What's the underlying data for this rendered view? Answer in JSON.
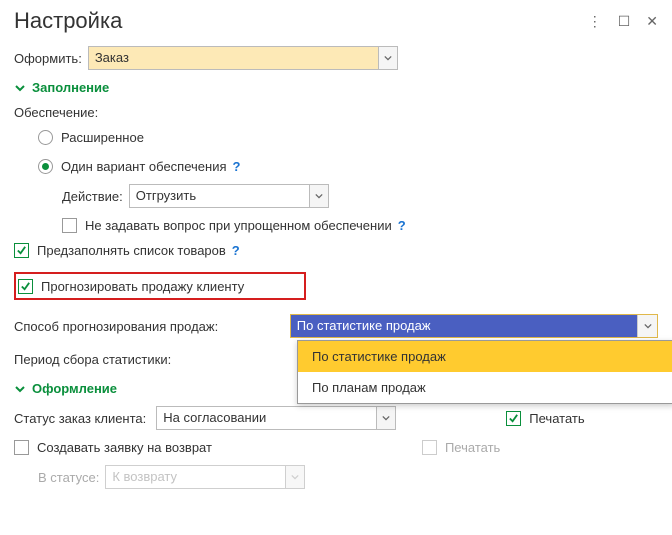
{
  "header": {
    "title": "Настройка"
  },
  "oformit": {
    "label": "Оформить:",
    "value": "Заказ"
  },
  "sections": {
    "fill": "Заполнение",
    "design": "Оформление"
  },
  "obespechenie": {
    "label": "Обеспечение:",
    "opt_extended": "Расширенное",
    "opt_single": "Один вариант обеспечения"
  },
  "action": {
    "label": "Действие:",
    "value": "Отгрузить"
  },
  "noask": "Не задавать вопрос при упрощенном обеспечении",
  "prefill": "Предзаполнять список товаров",
  "forecast_client": "Прогнозировать продажу клиенту",
  "forecast_method": {
    "label": "Способ прогнозирования продаж:",
    "value": "По статистике продаж",
    "options": [
      "По статистике продаж",
      "По планам продаж"
    ]
  },
  "stat_period": {
    "label": "Период сбора статистики:"
  },
  "status": {
    "label": "Статус заказ клиента:",
    "value": "На согласовании"
  },
  "print": "Печатать",
  "print_disabled": "Печатать",
  "create_return": "Создавать заявку на возврат",
  "in_status": {
    "label": "В статусе:",
    "value": "К возврату"
  }
}
